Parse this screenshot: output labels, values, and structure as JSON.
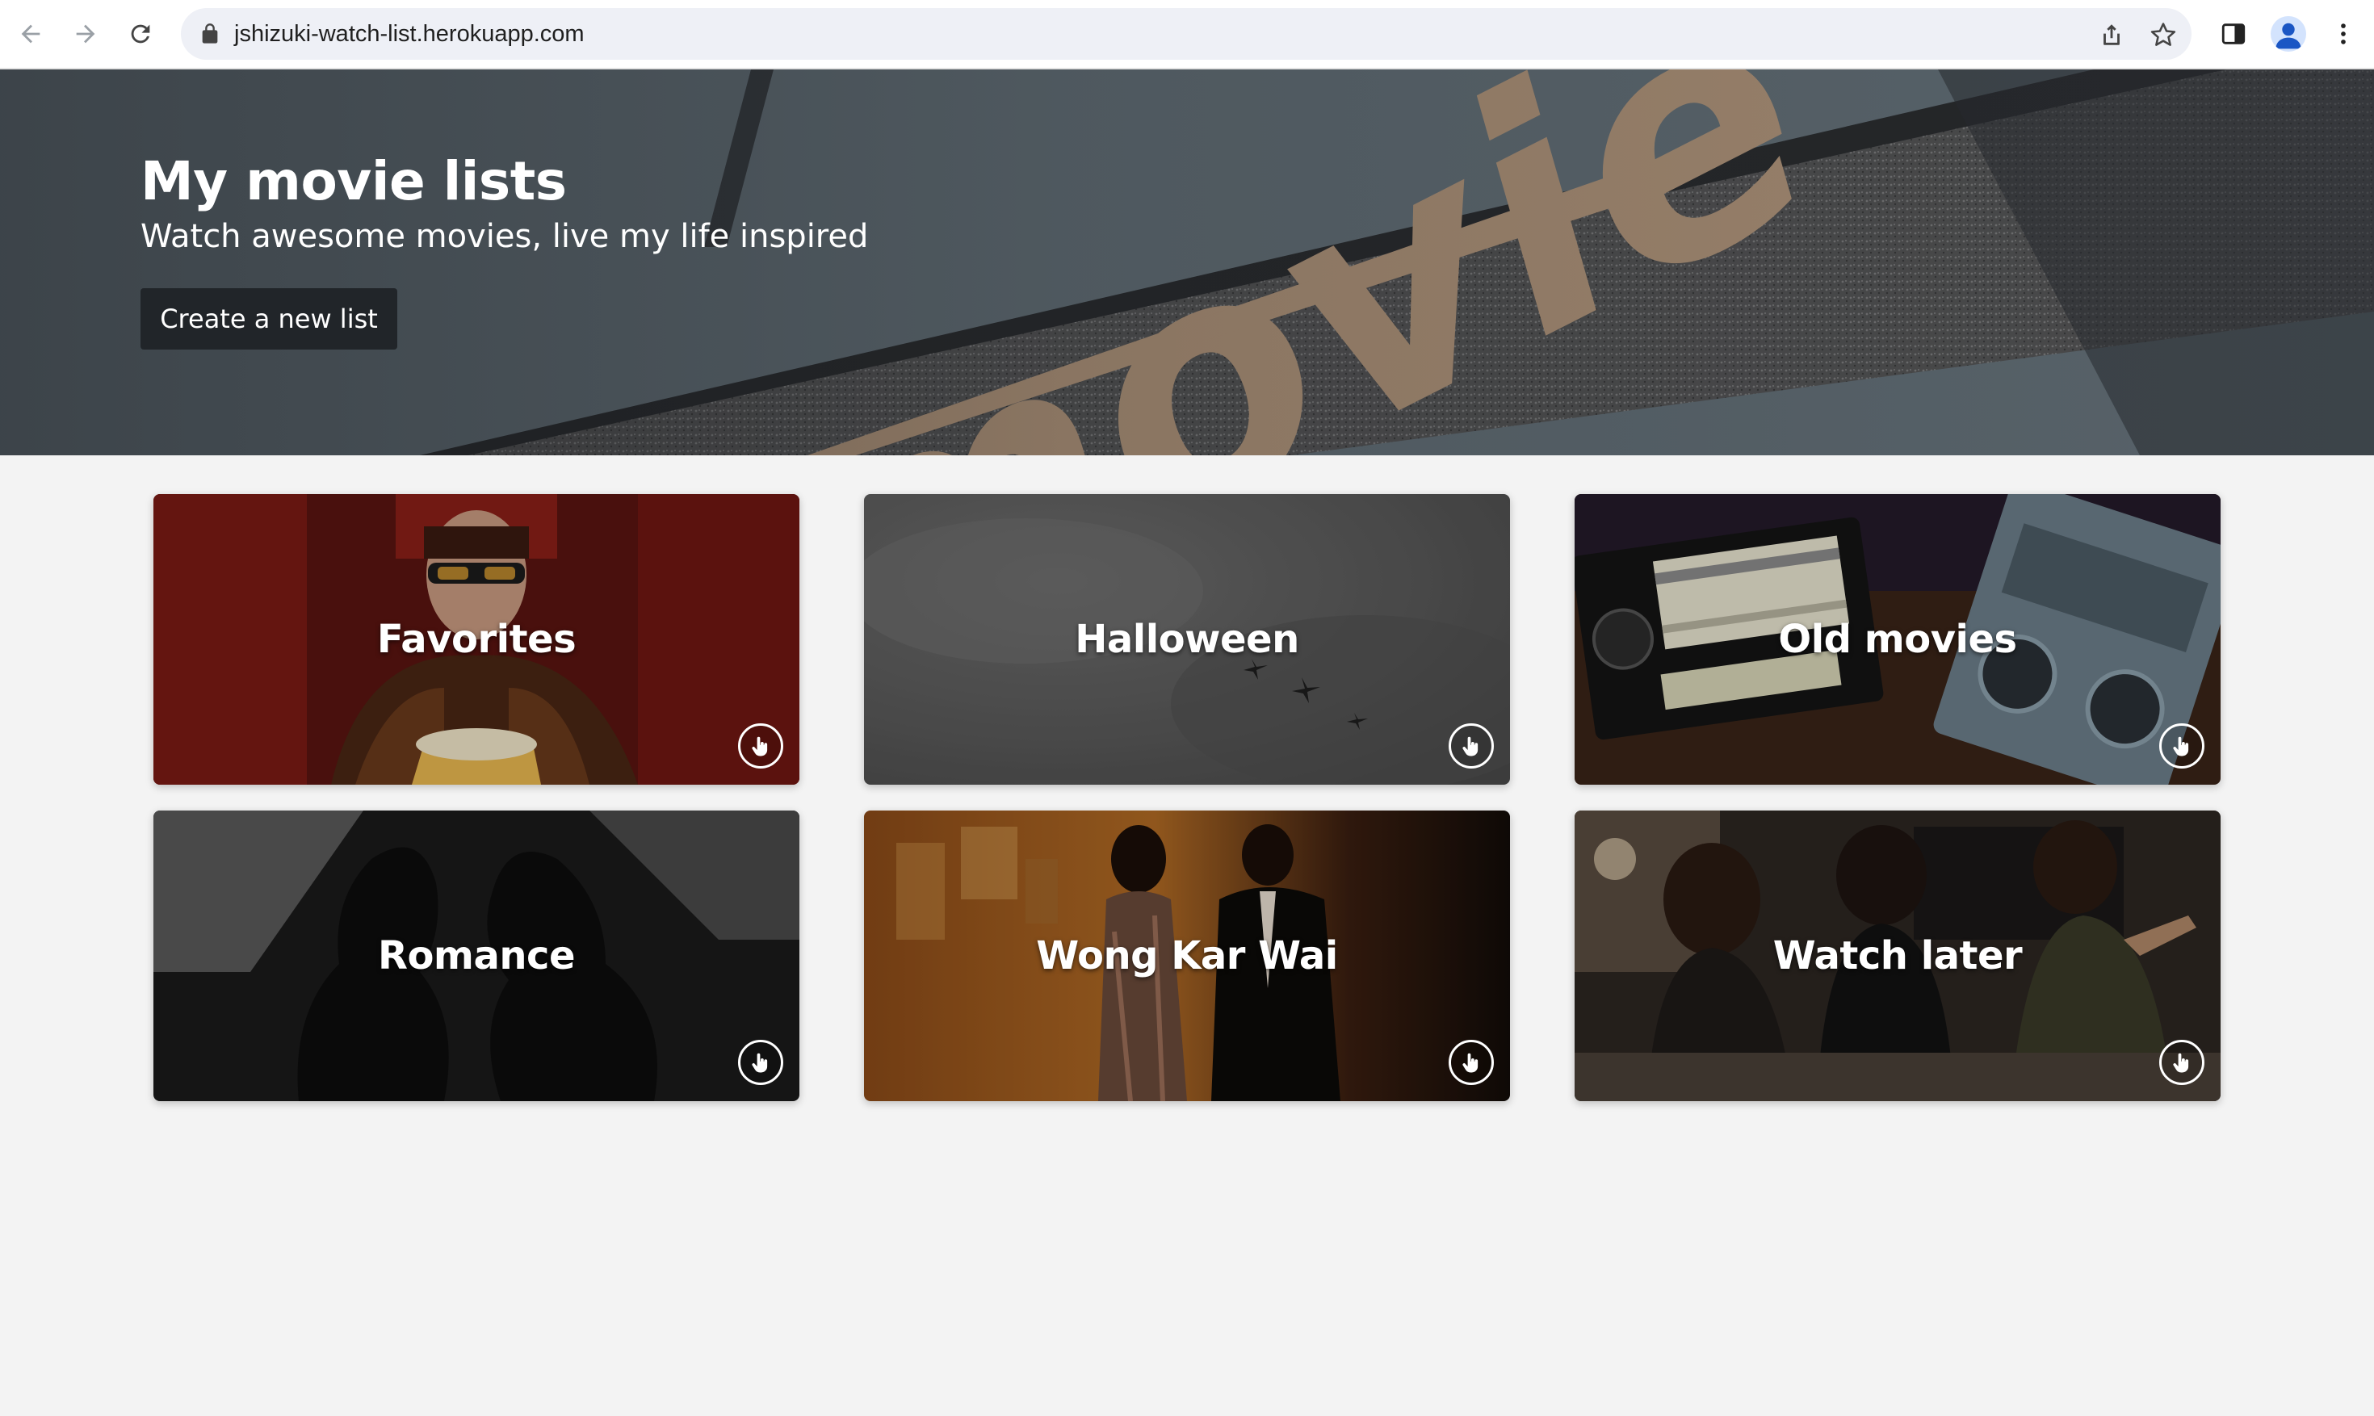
{
  "browser": {
    "url": "jshizuki-watch-list.herokuapp.com",
    "icons": [
      "back-arrow-icon",
      "forward-arrow-icon",
      "reload-icon",
      "lock-icon",
      "share-icon",
      "star-icon",
      "side-panel-icon",
      "profile-icon",
      "more-vert-icon"
    ]
  },
  "hero": {
    "title": "My movie lists",
    "subtitle": "Watch awesome movies, live my life inspired",
    "button_label": "Create a new list",
    "sign_text": "movie"
  },
  "lists": [
    {
      "title": "Favorites"
    },
    {
      "title": "Halloween"
    },
    {
      "title": "Old movies"
    },
    {
      "title": "Romance"
    },
    {
      "title": "Wong Kar Wai"
    },
    {
      "title": "Watch later"
    }
  ],
  "colors": {
    "page_background": "#f3f3f3",
    "button_background": "#212529",
    "button_text": "#ffffff",
    "omnibox_background": "#eef0f6"
  }
}
